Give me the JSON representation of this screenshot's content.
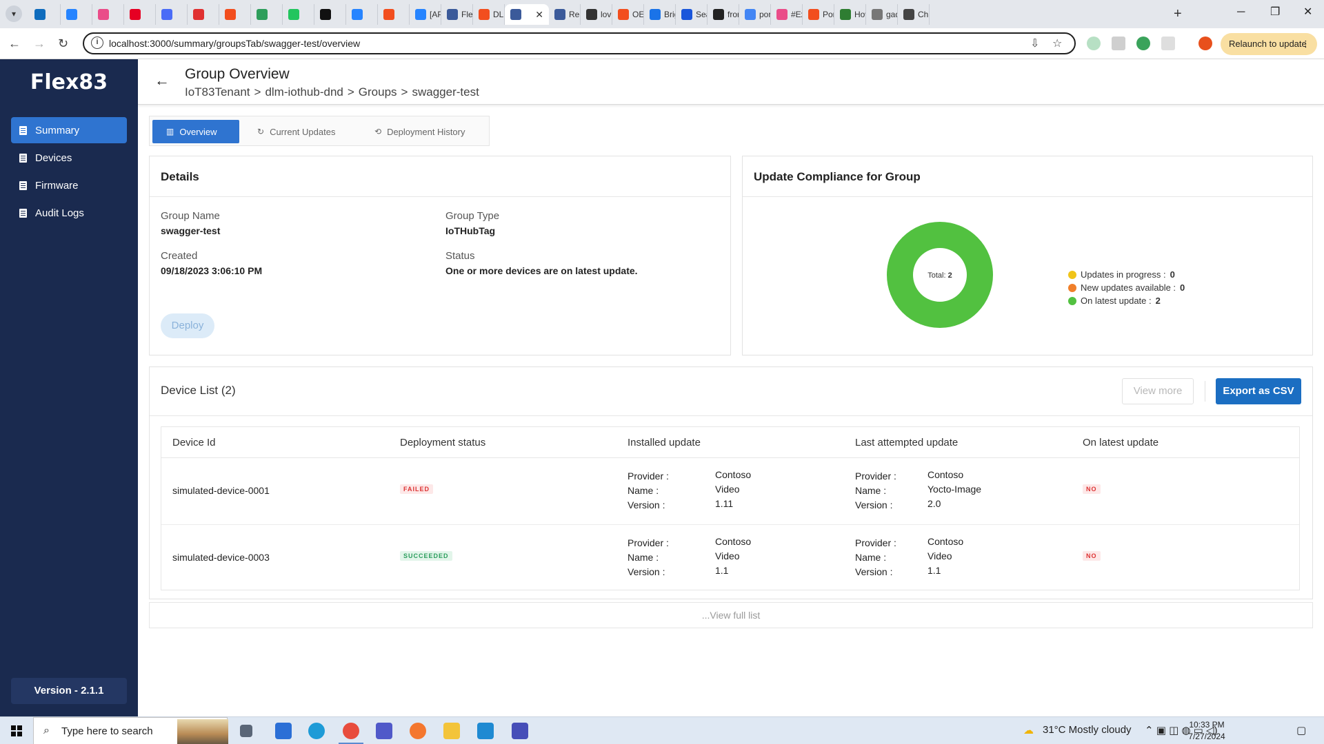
{
  "browser": {
    "tabs": [
      {
        "label": "",
        "fav": "#0f6cbd"
      },
      {
        "label": "",
        "fav": "#2684ff"
      },
      {
        "label": "",
        "fav": "#ea4c89"
      },
      {
        "label": "",
        "fav": "#e60023"
      },
      {
        "label": "",
        "fav": "#4a6cf7"
      },
      {
        "label": "",
        "fav": "#e03131"
      },
      {
        "label": "",
        "fav": "#f24e1e"
      },
      {
        "label": "",
        "fav": "#2e9e5b"
      },
      {
        "label": "",
        "fav": "#22c55e"
      },
      {
        "label": "",
        "fav": "#111111"
      },
      {
        "label": "",
        "fav": "#2684ff"
      },
      {
        "label": "",
        "fav": "#f24e1e"
      },
      {
        "label": "[API",
        "fav": "#2684ff"
      },
      {
        "label": "Flex",
        "fav": "#3b5a9a"
      },
      {
        "label": "DLM",
        "fav": "#f24e1e"
      },
      {
        "label": "",
        "fav": "#3b5a9a",
        "active": true
      },
      {
        "label": "Reac",
        "fav": "#3b5a9a"
      },
      {
        "label": "lovi",
        "fav": "#333333"
      },
      {
        "label": "OED",
        "fav": "#f24e1e"
      },
      {
        "label": "Brig",
        "fav": "#1a73e8"
      },
      {
        "label": "Sear",
        "fav": "#1a56db"
      },
      {
        "label": "fron",
        "fav": "#222222"
      },
      {
        "label": "port",
        "fav": "#4285f4"
      },
      {
        "label": "#Exp",
        "fav": "#ea4c89"
      },
      {
        "label": "Port",
        "fav": "#f24e1e"
      },
      {
        "label": "How",
        "fav": "#2e7d32"
      },
      {
        "label": "gad",
        "fav": "#777777"
      },
      {
        "label": "Cha",
        "fav": "#444444"
      }
    ],
    "new_tab": "+",
    "window_minimize": "─",
    "window_restore": "❐",
    "window_close": "✕",
    "url": "localhost:3000/summary/groupsTab/swagger-test/overview",
    "relaunch_label": "Relaunch to update"
  },
  "sidebar": {
    "logo": "Flex83",
    "items": [
      {
        "label": "Summary",
        "active": true
      },
      {
        "label": "Devices"
      },
      {
        "label": "Firmware"
      },
      {
        "label": "Audit Logs"
      }
    ],
    "version": "Version - 2.1.1"
  },
  "header": {
    "title": "Group Overview",
    "breadcrumb": [
      "IoT83Tenant",
      ">",
      "dlm-iothub-dnd",
      ">",
      "Groups",
      ">",
      "swagger-test"
    ]
  },
  "tabs": [
    {
      "label": "Overview",
      "icon": "chart-icon",
      "active": true
    },
    {
      "label": "Current Updates",
      "icon": "refresh-icon"
    },
    {
      "label": "Deployment History",
      "icon": "history-icon"
    }
  ],
  "details": {
    "title": "Details",
    "group_name_label": "Group Name",
    "group_name": "swagger-test",
    "group_type_label": "Group Type",
    "group_type": "IoTHubTag",
    "created_label": "Created",
    "created": "09/18/2023 3:06:10 PM",
    "status_label": "Status",
    "status": "One or more devices are on latest update.",
    "deploy_label": "Deploy"
  },
  "compliance": {
    "title": "Update Compliance for Group",
    "total_label": "Total:",
    "total": "2",
    "legend": [
      {
        "label": "Updates in progress :",
        "value": "0",
        "color": "#f0c419"
      },
      {
        "label": "New updates available :",
        "value": "0",
        "color": "#f07f2a"
      },
      {
        "label": "On latest update :",
        "value": "2",
        "color": "#52c140"
      }
    ]
  },
  "device_list": {
    "title": "Device List (2)",
    "view_more": "View more",
    "export": "Export as CSV",
    "columns": [
      "Device Id",
      "Deployment status",
      "Installed update",
      "Last attempted update",
      "On latest update"
    ],
    "kv_labels": [
      "Provider :",
      "Name :",
      "Version :"
    ],
    "rows": [
      {
        "device_id": "simulated-device-0001",
        "status": "FAILED",
        "installed": {
          "provider": "Contoso",
          "name": "Video",
          "version": "1.11"
        },
        "attempted": {
          "provider": "Contoso",
          "name": "Yocto-Image",
          "version": "2.0"
        },
        "latest": "NO"
      },
      {
        "device_id": "simulated-device-0003",
        "status": "SUCCEEDED",
        "installed": {
          "provider": "Contoso",
          "name": "Video",
          "version": "1.1"
        },
        "attempted": {
          "provider": "Contoso",
          "name": "Video",
          "version": "1.1"
        },
        "latest": "NO"
      }
    ],
    "view_full": "...View full list"
  },
  "taskbar": {
    "search_placeholder": "Type here to search",
    "weather": "31°C  Mostly cloudy",
    "time": "10:33 PM",
    "date": "7/27/2024"
  }
}
